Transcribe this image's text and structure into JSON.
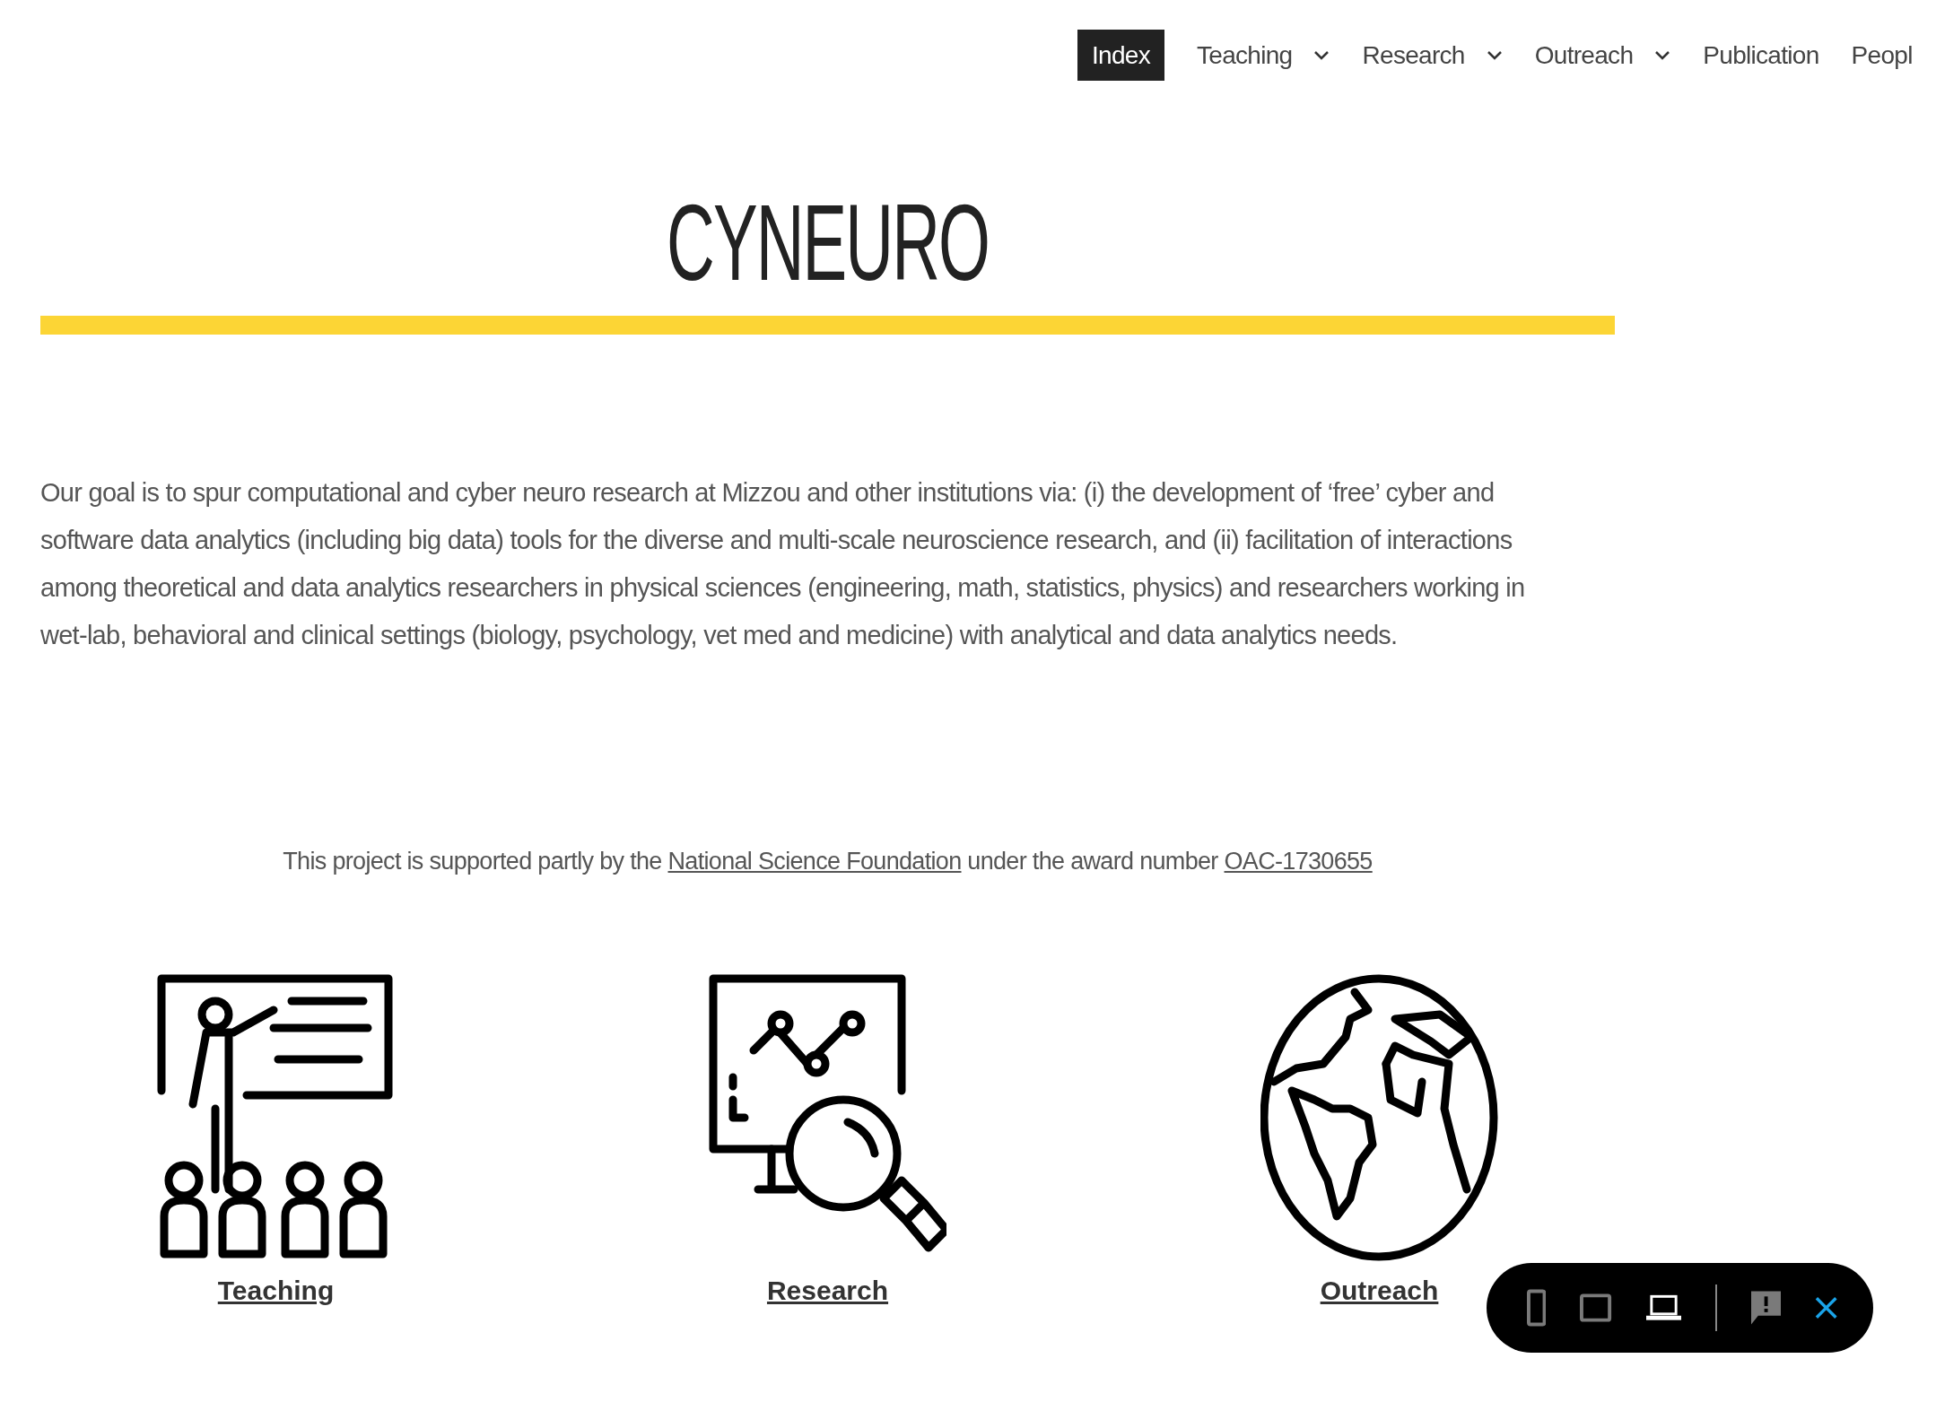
{
  "nav": [
    {
      "label": "Index",
      "selected": true,
      "has_menu": false
    },
    {
      "label": "Teaching",
      "selected": false,
      "has_menu": true
    },
    {
      "label": "Research",
      "selected": false,
      "has_menu": true
    },
    {
      "label": "Outreach",
      "selected": false,
      "has_menu": true
    },
    {
      "label": "Publication",
      "selected": false,
      "has_menu": false
    },
    {
      "label": "Peopl",
      "selected": false,
      "has_menu": false
    }
  ],
  "title": "CYNEURO",
  "intro": "Our goal is to spur computational and cyber neuro research at Mizzou and other institutions via: (i) the development of ‘free’ cyber and software data analytics (including big data) tools for the diverse and multi-scale neuroscience research, and (ii) facilitation of interactions among theoretical and data analytics researchers in physical sciences (engineering, math, statistics, physics) and researchers working in wet-lab, behavioral and clinical settings (biology, psychology, vet med and medicine) with analytical and data analytics needs.",
  "support": {
    "before": "This project is supported partly by the",
    "link1": "National Science Foundation",
    "middle": "under the award number",
    "link2": "OAC-1730655"
  },
  "sections": [
    {
      "kind": "teaching",
      "label": "Teaching"
    },
    {
      "kind": "research",
      "label": "Research"
    },
    {
      "kind": "outreach",
      "label": "Outreach"
    }
  ],
  "device_toolbar": [
    {
      "kind": "phone",
      "selected": false
    },
    {
      "kind": "tablet",
      "selected": false
    },
    {
      "kind": "laptop",
      "selected": true
    }
  ]
}
